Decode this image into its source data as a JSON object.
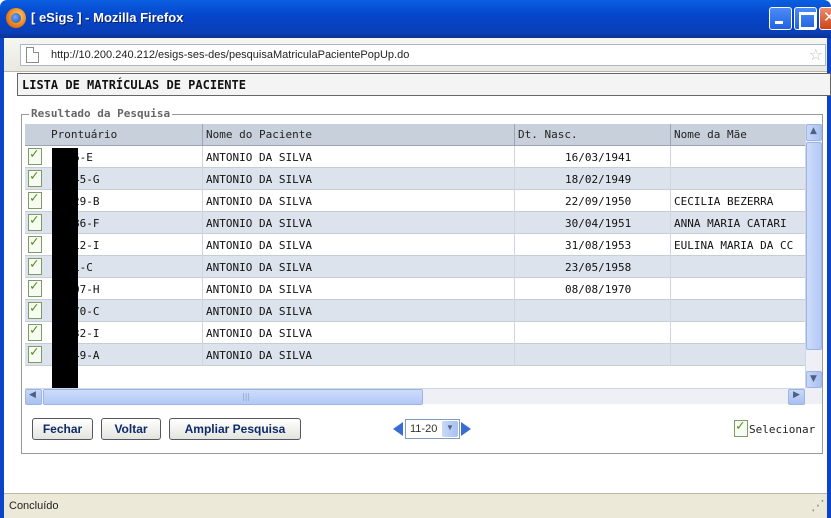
{
  "window": {
    "title": "[ eSigs ] - Mozilla Firefox",
    "url": "http://10.200.240.212/esigs-ses-des/pesquisaMatriculaPacientePopUp.do",
    "status": "Concluído"
  },
  "page": {
    "title": "LISTA DE MATRÍCULAS DE PACIENTE",
    "legend": "Resultado da Pesquisa"
  },
  "table": {
    "columns": [
      "Prontuário",
      "Nome do Paciente",
      "Dt. Nasc.",
      "Nome da Mãe"
    ],
    "rows": [
      {
        "prontuario": "6-E",
        "nome": "ANTONIO DA SILVA",
        "dt_nasc": "16/03/1941",
        "mae": ""
      },
      {
        "prontuario": "45-G",
        "nome": "ANTONIO DA SILVA",
        "dt_nasc": "18/02/1949",
        "mae": ""
      },
      {
        "prontuario": "29-B",
        "nome": "ANTONIO DA SILVA",
        "dt_nasc": "22/09/1950",
        "mae": "CECILIA BEZERRA"
      },
      {
        "prontuario": "86-F",
        "nome": "ANTONIO DA SILVA",
        "dt_nasc": "30/04/1951",
        "mae": "ANNA MARIA CATARI"
      },
      {
        "prontuario": "12-I",
        "nome": "ANTONIO DA SILVA",
        "dt_nasc": "31/08/1953",
        "mae": "EULINA MARIA DA CC"
      },
      {
        "prontuario": "1-C",
        "nome": "ANTONIO DA SILVA",
        "dt_nasc": "23/05/1958",
        "mae": ""
      },
      {
        "prontuario": "07-H",
        "nome": "ANTONIO DA SILVA",
        "dt_nasc": "08/08/1970",
        "mae": ""
      },
      {
        "prontuario": "70-C",
        "nome": "ANTONIO DA SILVA",
        "dt_nasc": "",
        "mae": ""
      },
      {
        "prontuario": "32-I",
        "nome": "ANTONIO DA SILVA",
        "dt_nasc": "",
        "mae": ""
      },
      {
        "prontuario": "49-A",
        "nome": "ANTONIO DA SILVA",
        "dt_nasc": "",
        "mae": ""
      }
    ]
  },
  "buttons": {
    "fechar": "Fechar",
    "voltar": "Voltar",
    "ampliar": "Ampliar Pesquisa"
  },
  "pager": {
    "selected": "11-20"
  },
  "selecionar_label": "Selecionar"
}
